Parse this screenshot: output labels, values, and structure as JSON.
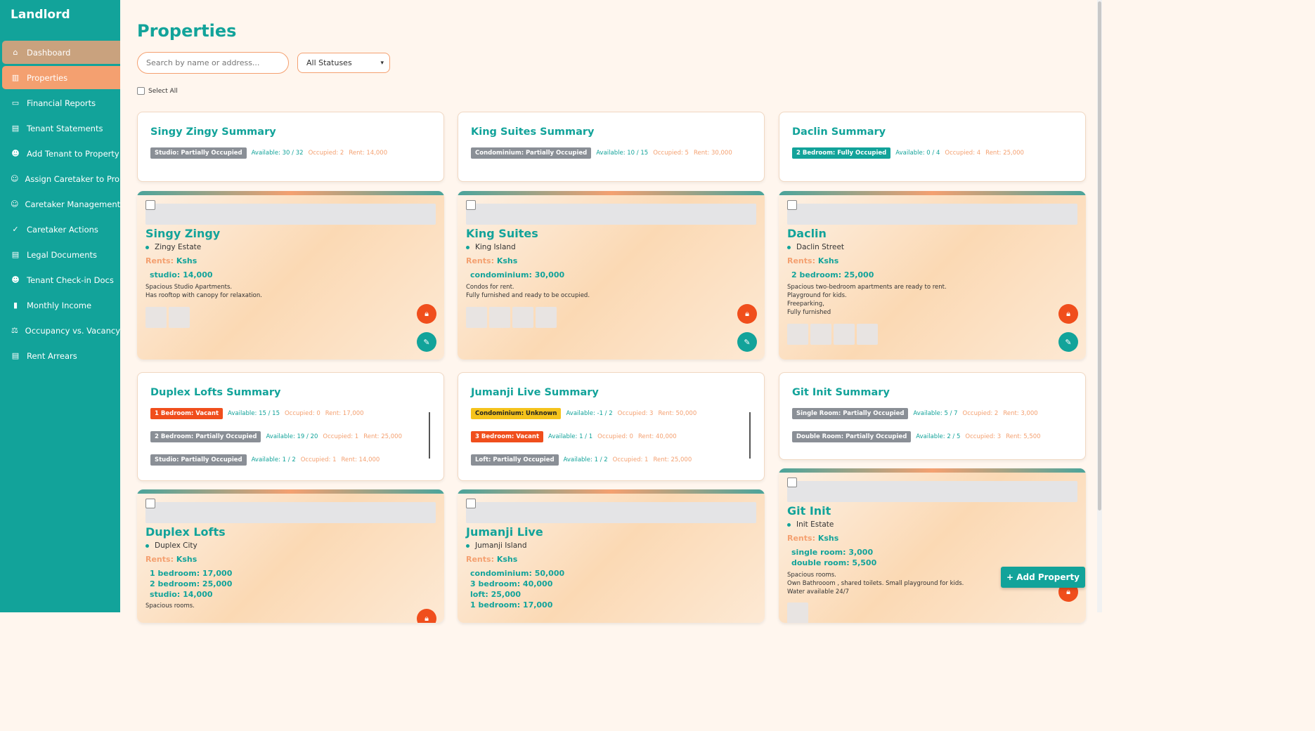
{
  "sidebar": {
    "brand": "Landlord",
    "items": [
      {
        "label": "Dashboard",
        "icon": "home-icon"
      },
      {
        "label": "Properties",
        "icon": "building-icon"
      },
      {
        "label": "Financial Reports",
        "icon": "money-icon"
      },
      {
        "label": "Tenant Statements",
        "icon": "document-icon"
      },
      {
        "label": "Add Tenant to Property",
        "icon": "users-icon"
      },
      {
        "label": "Assign Caretaker to Property",
        "icon": "user-icon"
      },
      {
        "label": "Caretaker Management",
        "icon": "user-icon"
      },
      {
        "label": "Caretaker Actions",
        "icon": "clipboard-check-icon"
      },
      {
        "label": "Legal Documents",
        "icon": "document-icon"
      },
      {
        "label": "Tenant Check-in Docs",
        "icon": "users-icon"
      },
      {
        "label": "Monthly Income",
        "icon": "bar-chart-icon"
      },
      {
        "label": "Occupancy vs. Vacancy",
        "icon": "balance-scale-icon"
      },
      {
        "label": "Rent Arrears",
        "icon": "receipt-icon"
      }
    ]
  },
  "main": {
    "title": "Properties",
    "search_placeholder": "Search by name or address...",
    "status_filter": "All Statuses",
    "select_all": "Select All",
    "add_property": "+ Add Property"
  },
  "summaries": [
    {
      "title": "Singy Zingy Summary",
      "rows": [
        {
          "badge": "Studio: Partially Occupied",
          "available": "Available: 30 / 32",
          "occupied": "Occupied: 2",
          "rent": "Rent: 14,000"
        }
      ]
    },
    {
      "title": "King Suites Summary",
      "rows": [
        {
          "badge": "Condominium: Partially Occupied",
          "available": "Available: 10 / 15",
          "occupied": "Occupied: 5",
          "rent": "Rent: 30,000"
        }
      ]
    },
    {
      "title": "Daclin Summary",
      "rows": [
        {
          "badge": "2 Bedroom: Fully Occupied",
          "available": "Available: 0 / 4",
          "occupied": "Occupied: 4",
          "rent": "Rent: 25,000"
        }
      ]
    },
    {
      "title": "Duplex Lofts Summary",
      "rows": [
        {
          "badge": "1 Bedroom: Vacant",
          "available": "Available: 15 / 15",
          "occupied": "Occupied: 0",
          "rent": "Rent: 17,000"
        },
        {
          "badge": "2 Bedroom: Partially Occupied",
          "available": "Available: 19 / 20",
          "occupied": "Occupied: 1",
          "rent": "Rent: 25,000"
        },
        {
          "badge": "Studio: Partially Occupied",
          "available": "Available: 1 / 2",
          "occupied": "Occupied: 1",
          "rent": "Rent: 14,000"
        }
      ]
    },
    {
      "title": "Jumanji Live Summary",
      "rows": [
        {
          "badge": "Condominium: Unknown",
          "available": "Available: -1 / 2",
          "occupied": "Occupied: 3",
          "rent": "Rent: 50,000"
        },
        {
          "badge": "3 Bedroom: Vacant",
          "available": "Available: 1 / 1",
          "occupied": "Occupied: 0",
          "rent": "Rent: 40,000"
        },
        {
          "badge": "Loft: Partially Occupied",
          "available": "Available: 1 / 2",
          "occupied": "Occupied: 1",
          "rent": "Rent: 25,000"
        }
      ]
    },
    {
      "title": "Git Init Summary",
      "rows": [
        {
          "badge": "Single Room: Partially Occupied",
          "available": "Available: 5 / 7",
          "occupied": "Occupied: 2",
          "rent": "Rent: 3,000"
        },
        {
          "badge": "Double Room: Partially Occupied",
          "available": "Available: 2 / 5",
          "occupied": "Occupied: 3",
          "rent": "Rent: 5,500"
        }
      ]
    }
  ],
  "properties": [
    {
      "name": "Singy Zingy",
      "location": "Zingy Estate",
      "rents_label": "Rents:",
      "currency": "Kshs",
      "rents": [
        "studio: 14,000"
      ],
      "description": [
        "Spacious Studio Apartments.",
        "Has rooftop with canopy for relaxation."
      ]
    },
    {
      "name": "King Suites",
      "location": "King Island",
      "rents_label": "Rents:",
      "currency": "Kshs",
      "rents": [
        "condominium: 30,000"
      ],
      "description": [
        "Condos for rent.",
        "Fully furnished and ready to be occupied."
      ]
    },
    {
      "name": "Daclin",
      "location": "Daclin Street",
      "rents_label": "Rents:",
      "currency": "Kshs",
      "rents": [
        "2 bedroom: 25,000"
      ],
      "description": [
        "Spacious two-bedroom apartments are ready to rent.",
        "Playground for kids.",
        "Freeparking,",
        "Fully furnished"
      ]
    },
    {
      "name": "Duplex Lofts",
      "location": "Duplex City",
      "rents_label": "Rents:",
      "currency": "Kshs",
      "rents": [
        "1 bedroom: 17,000",
        "2 bedroom: 25,000",
        "studio: 14,000"
      ],
      "description": [
        "Spacious rooms."
      ]
    },
    {
      "name": "Jumanji Live",
      "location": "Jumanji Island",
      "rents_label": "Rents:",
      "currency": "Kshs",
      "rents": [
        "condominium: 50,000",
        "3 bedroom: 40,000",
        "loft: 25,000",
        "1 bedroom: 17,000"
      ],
      "description": []
    },
    {
      "name": "Git Init",
      "location": "Init Estate",
      "rents_label": "Rents:",
      "currency": "Kshs",
      "rents": [
        "single room: 3,000",
        "double room: 5,500"
      ],
      "description": [
        "Spacious rooms.",
        "Own Bathrooom , shared toilets. Small playground for kids.",
        "Water available 24/7"
      ]
    }
  ],
  "colors": {
    "primary": "#12a39a",
    "accent": "#f4a070",
    "danger": "#f04e1c",
    "warning": "#f5c31c",
    "muted": "#8a8f96"
  }
}
